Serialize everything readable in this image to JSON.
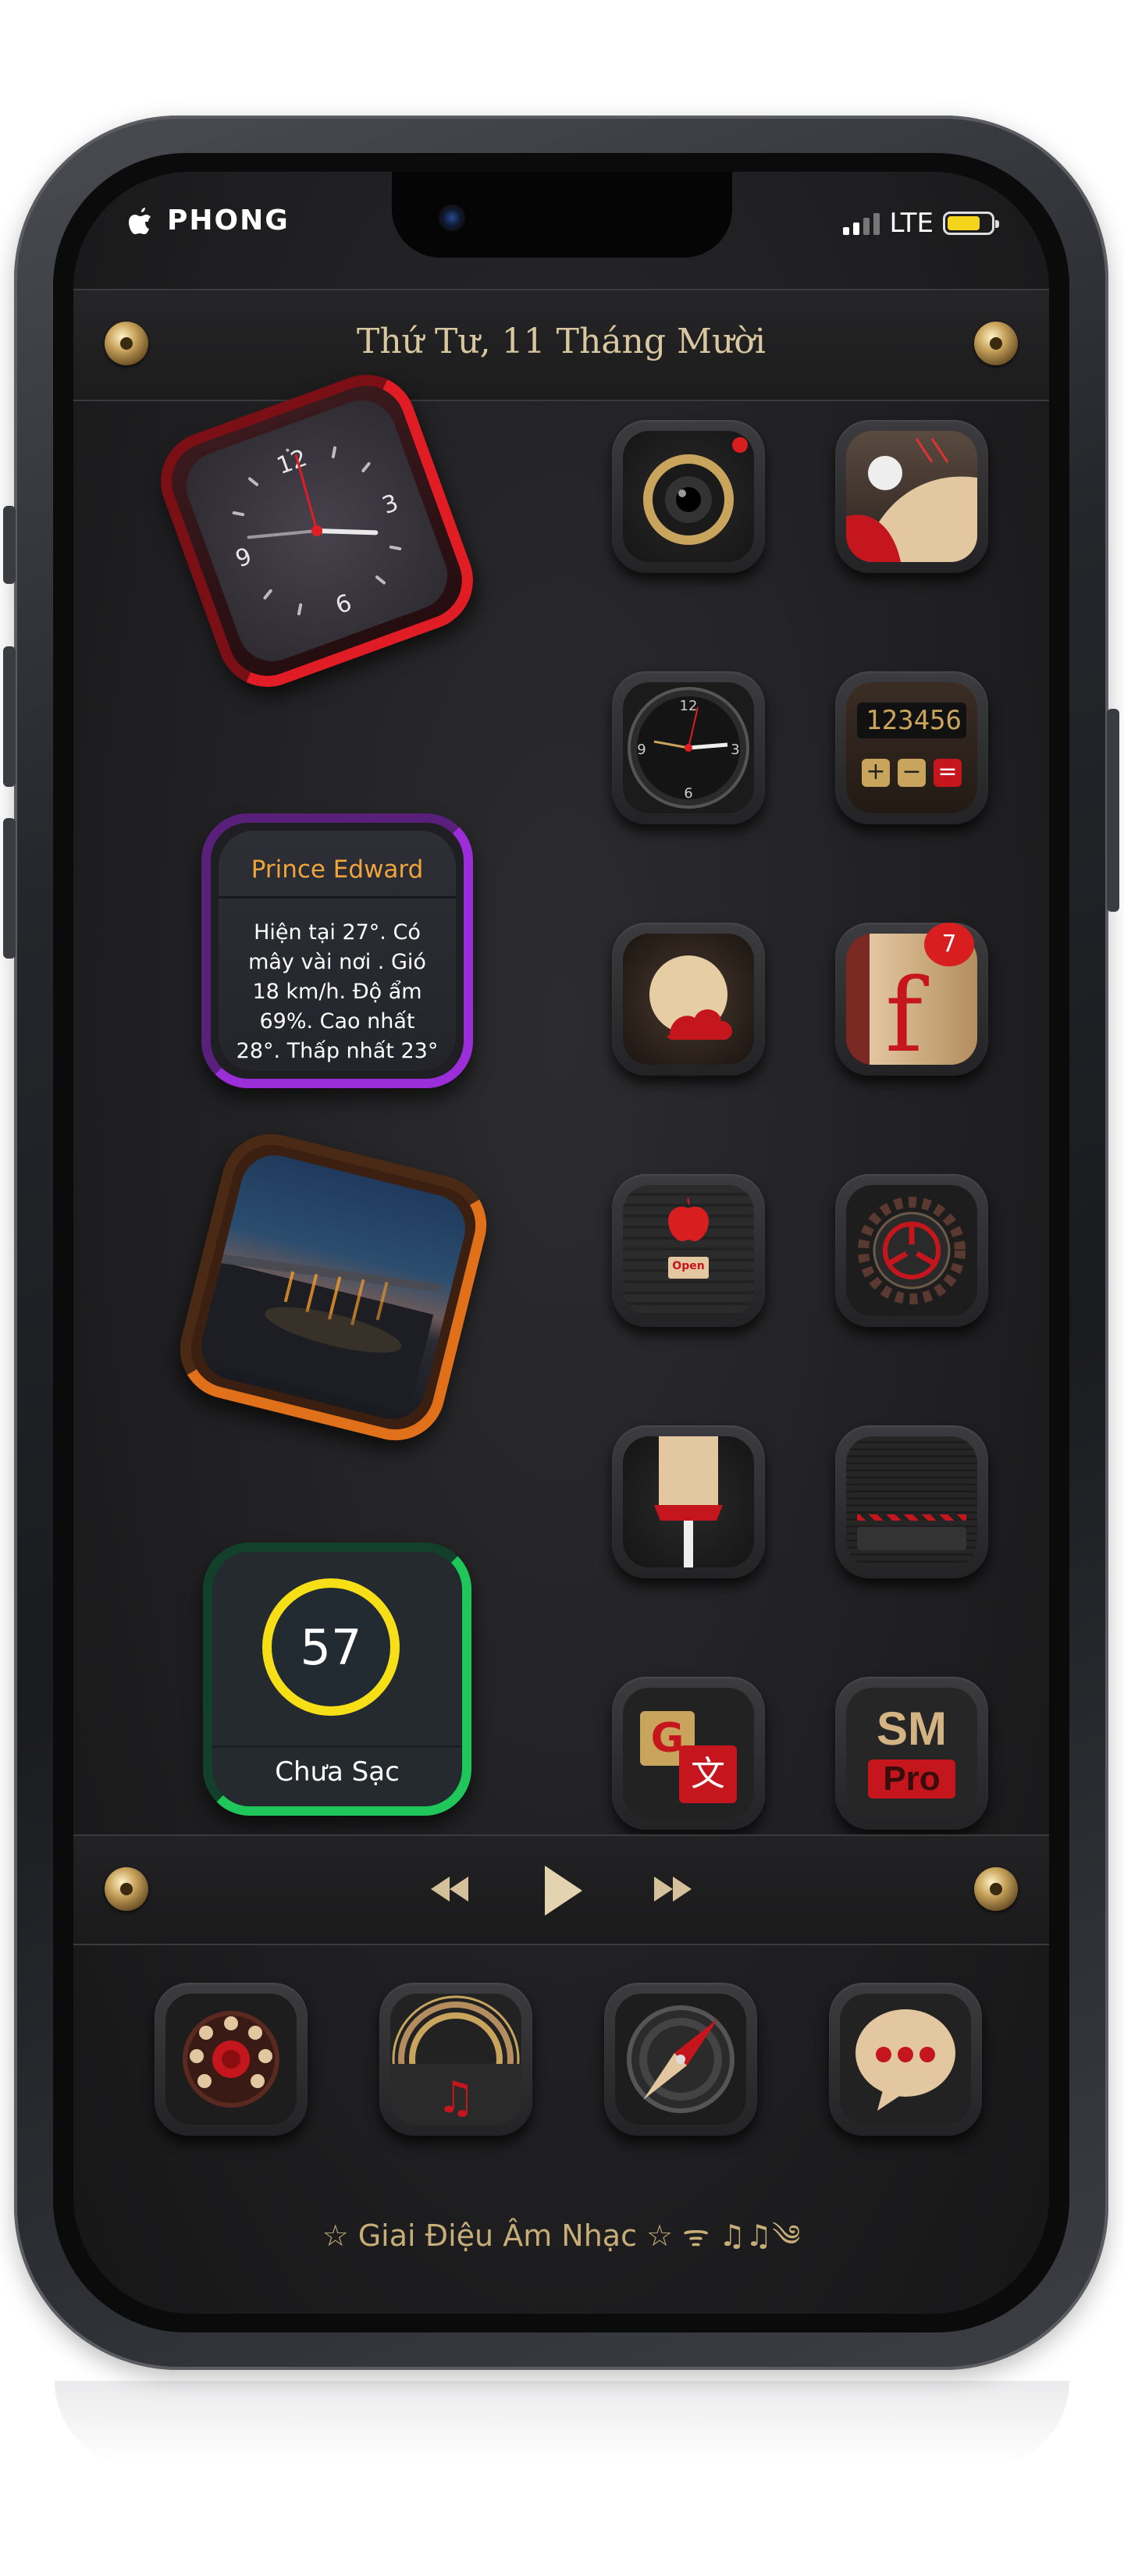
{
  "status_bar": {
    "carrier": "PHONG",
    "network": "LTE",
    "battery_level": 0.75,
    "battery_color": "#f5d51b"
  },
  "header": {
    "date": "Thứ Tư, 11 Tháng Mười"
  },
  "clock_widget": {
    "numbers": [
      "12",
      "3",
      "6",
      "9"
    ],
    "accent_color": "#e01d25"
  },
  "weather_widget": {
    "city": "Prince Edward",
    "description": "Hiện tại 27°. Có mây vài nơi . Gió 18 km/h. Độ ẩm 69%. Cao nhất 28°. Thấp nhất 23°",
    "accent_color": "#9b2ed8"
  },
  "photo_widget": {
    "accent_color": "#e0701a"
  },
  "battery_widget": {
    "value": "57",
    "status": "Chưa Sạc",
    "accent_color": "#1fc65a",
    "ring_color": "#f7df18"
  },
  "apps": [
    {
      "icon": "camera-icon"
    },
    {
      "icon": "game-ball-icon"
    },
    {
      "icon": "clock-app-icon"
    },
    {
      "icon": "calculator-icon",
      "display": "123456"
    },
    {
      "icon": "weather-icon"
    },
    {
      "icon": "facebook-icon",
      "badge": "7"
    },
    {
      "icon": "app-store-icon",
      "sign": "Open"
    },
    {
      "icon": "settings-gear-icon"
    },
    {
      "icon": "paint-brush-icon"
    },
    {
      "icon": "video-editor-icon"
    },
    {
      "icon": "translate-icon",
      "letter": "G",
      "glyph": "文"
    },
    {
      "icon": "sm-pro-icon",
      "line1": "SM",
      "line2": "Pro"
    }
  ],
  "music_controls": {
    "previous": "rewind-icon",
    "play": "play-icon",
    "next": "fast-forward-icon"
  },
  "dock": {
    "apps": [
      "phone-rotary-icon",
      "music-record-icon",
      "compass-icon",
      "messages-icon"
    ],
    "label": "☆ Giai Điệu Âm Nhạc ☆ ᯤ ♫♫༄"
  }
}
